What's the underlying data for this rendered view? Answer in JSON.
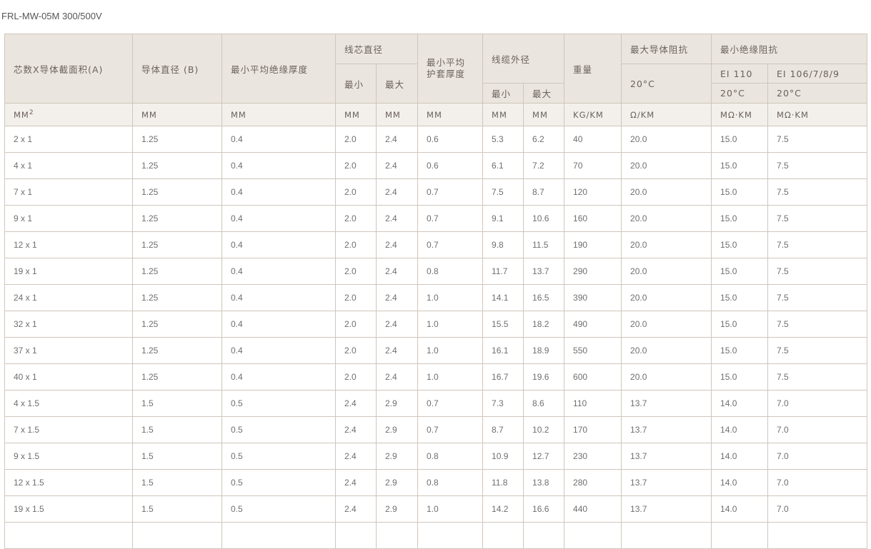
{
  "title": "FRL-MW-05M 300/500V",
  "headers": {
    "cores_area": "芯数X导体截面积(A)",
    "conductor_diameter": "导体直径 (B)",
    "min_avg_insulation": "最小平均绝缘厚度",
    "core_diameter": "线芯直径",
    "min_avg_sheath": "最小平均护套厚度",
    "cable_od": "线缆外径",
    "weight": "重量",
    "max_conductor_resistance": "最大导体阻抗",
    "min_insulation_resistance": "最小绝缘阻抗",
    "min": "最小",
    "max": "最大",
    "temp_20": "20°C",
    "ei110": "EI 110",
    "ei106": "EI 106/7/8/9"
  },
  "units": {
    "area": "MM",
    "area_sup": "2",
    "conductor_diameter": "MM",
    "insulation": "MM",
    "core_min": "MM",
    "core_max": "MM",
    "sheath": "MM",
    "od_min": "MM",
    "od_max": "MM",
    "weight": "KG/KM",
    "resistance": "Ω/KM",
    "ins_ei110": "MΩ·KM",
    "ins_ei106": "MΩ·KM"
  },
  "rows": [
    [
      "2 x 1",
      "1.25",
      "0.4",
      "2.0",
      "2.4",
      "0.6",
      "5.3",
      "6.2",
      "40",
      "20.0",
      "15.0",
      "7.5"
    ],
    [
      "4 x 1",
      "1.25",
      "0.4",
      "2.0",
      "2.4",
      "0.6",
      "6.1",
      "7.2",
      "70",
      "20.0",
      "15.0",
      "7.5"
    ],
    [
      "7 x 1",
      "1.25",
      "0.4",
      "2.0",
      "2.4",
      "0.7",
      "7.5",
      "8.7",
      "120",
      "20.0",
      "15.0",
      "7.5"
    ],
    [
      "9 x 1",
      "1.25",
      "0.4",
      "2.0",
      "2.4",
      "0.7",
      "9.1",
      "10.6",
      "160",
      "20.0",
      "15.0",
      "7.5"
    ],
    [
      "12 x 1",
      "1.25",
      "0.4",
      "2.0",
      "2.4",
      "0.7",
      "9.8",
      "11.5",
      "190",
      "20.0",
      "15.0",
      "7.5"
    ],
    [
      "19 x 1",
      "1.25",
      "0.4",
      "2.0",
      "2.4",
      "0.8",
      "11.7",
      "13.7",
      "290",
      "20.0",
      "15.0",
      "7.5"
    ],
    [
      "24 x 1",
      "1.25",
      "0.4",
      "2.0",
      "2.4",
      "1.0",
      "14.1",
      "16.5",
      "390",
      "20.0",
      "15.0",
      "7.5"
    ],
    [
      "32 x 1",
      "1.25",
      "0.4",
      "2.0",
      "2.4",
      "1.0",
      "15.5",
      "18.2",
      "490",
      "20.0",
      "15.0",
      "7.5"
    ],
    [
      "37 x 1",
      "1.25",
      "0.4",
      "2.0",
      "2.4",
      "1.0",
      "16.1",
      "18.9",
      "550",
      "20.0",
      "15.0",
      "7.5"
    ],
    [
      "40 x 1",
      "1.25",
      "0.4",
      "2.0",
      "2.4",
      "1.0",
      "16.7",
      "19.6",
      "600",
      "20.0",
      "15.0",
      "7.5"
    ],
    [
      "4 x 1.5",
      "1.5",
      "0.5",
      "2.4",
      "2.9",
      "0.7",
      "7.3",
      "8.6",
      "110",
      "13.7",
      "14.0",
      "7.0"
    ],
    [
      "7 x 1.5",
      "1.5",
      "0.5",
      "2.4",
      "2.9",
      "0.7",
      "8.7",
      "10.2",
      "170",
      "13.7",
      "14.0",
      "7.0"
    ],
    [
      "9 x 1.5",
      "1.5",
      "0.5",
      "2.4",
      "2.9",
      "0.8",
      "10.9",
      "12.7",
      "230",
      "13.7",
      "14.0",
      "7.0"
    ],
    [
      "12 x 1.5",
      "1.5",
      "0.5",
      "2.4",
      "2.9",
      "0.8",
      "11.8",
      "13.8",
      "280",
      "13.7",
      "14.0",
      "7.0"
    ],
    [
      "19 x 1.5",
      "1.5",
      "0.5",
      "2.4",
      "2.9",
      "1.0",
      "14.2",
      "16.6",
      "440",
      "13.7",
      "14.0",
      "7.0"
    ],
    [
      "",
      "",
      "",
      "",
      "",
      "",
      "",
      "",
      "",
      "",
      "",
      ""
    ]
  ]
}
